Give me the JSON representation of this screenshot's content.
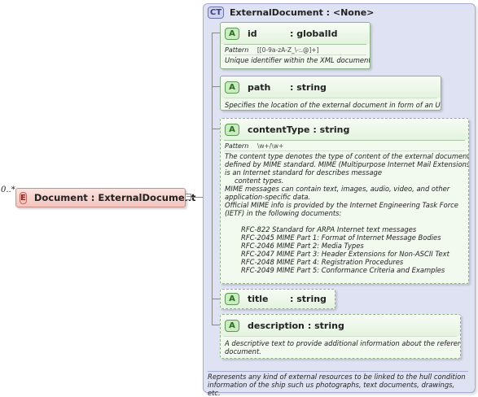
{
  "element": {
    "occurrence": "0..*",
    "badge": "E",
    "label": "Document : ExternalDocument",
    "expander": "−"
  },
  "complex_type": {
    "badge": "CT",
    "label": "ExternalDocument : <None>",
    "documentation_lines": [
      "Represents any kind of external resources to be linked to the hull condition",
      "information of the ship such us photographs, text documents, drawings, etc."
    ]
  },
  "attributes": [
    {
      "badge": "A",
      "name": "id",
      "type": ": globalId",
      "facet_label": "Pattern",
      "facet_value": "[[0-9a-zA-Z_\\-:.@]+]",
      "doc_lines": [
        "Unique identifier within the XML document."
      ]
    },
    {
      "badge": "A",
      "name": "path",
      "type": ": string",
      "doc_lines": [
        "Specifies the location of the external document in form of an URI."
      ]
    },
    {
      "badge": "A",
      "name": "contentType",
      "type": ": string",
      "facet_label": "Pattern",
      "facet_value": "\\w+/\\w+",
      "doc_lines": [
        "The content type denotes the type of content of the external document as",
        "defined by MIME standard. MIME (Multipurpose Internet Mail Extensions)",
        "is an Internet standard for describes message",
        "content types.",
        "MIME messages can contain text, images, audio, video, and other",
        "application-specific data.",
        "Official MIME info is provided by the Internet Engineering Task Force",
        "(IETF) in the following documents:",
        "",
        "RFC-822 Standard for ARPA Internet text messages",
        "RFC-2045 MIME Part 1: Format of Internet Message Bodies",
        "RFC-2046 MIME Part 2: Media Types",
        "RFC-2047 MIME Part 3: Header Extensions for Non-ASCII Text",
        "RFC-2048 MIME Part 4: Registration Procedures",
        "RFC-2049 MIME Part 5: Conformance Criteria and Examples"
      ]
    },
    {
      "badge": "A",
      "name": "title",
      "type": ": string"
    },
    {
      "badge": "A",
      "name": "description",
      "type": ": string",
      "doc_lines": [
        "A descriptive text to provide additional information about the referenced",
        "document."
      ]
    }
  ]
}
